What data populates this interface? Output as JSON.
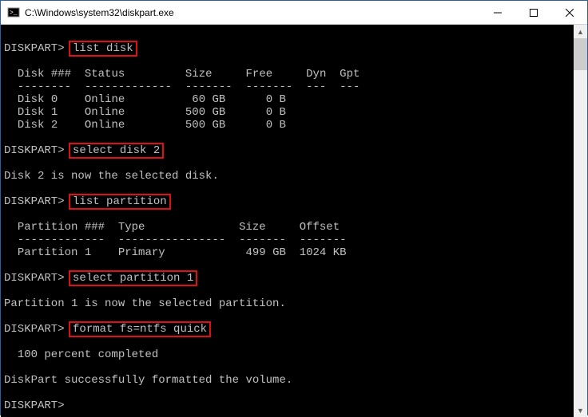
{
  "titlebar": {
    "title": "C:\\Windows\\system32\\diskpart.exe"
  },
  "prompt": "DISKPART>",
  "commands": {
    "c1": "list disk",
    "c2": "select disk 2",
    "c3": "list partition",
    "c4": "select partition 1",
    "c5": "format fs=ntfs quick"
  },
  "disk_header": {
    "col1": "Disk ###",
    "col2": "Status",
    "col3": "Size",
    "col4": "Free",
    "col5": "Dyn",
    "col6": "Gpt"
  },
  "disk_sep": {
    "col1": "--------",
    "col2": "-------------",
    "col3": "-------",
    "col4": "-------",
    "col5": "---",
    "col6": "---"
  },
  "disks": [
    {
      "id": "Disk 0",
      "status": "Online",
      "size": " 60 GB",
      "free": "    0 B"
    },
    {
      "id": "Disk 1",
      "status": "Online",
      "size": "500 GB",
      "free": "    0 B"
    },
    {
      "id": "Disk 2",
      "status": "Online",
      "size": "500 GB",
      "free": "    0 B"
    }
  ],
  "msg_disk_selected": "Disk 2 is now the selected disk.",
  "part_header": {
    "col1": "Partition ###",
    "col2": "Type",
    "col3": "Size",
    "col4": "Offset"
  },
  "part_sep": {
    "col1": "-------------",
    "col2": "----------------",
    "col3": "-------",
    "col4": "-------"
  },
  "partitions": [
    {
      "id": "Partition 1",
      "type": "Primary",
      "size": "499 GB",
      "offset": "1024 KB"
    }
  ],
  "msg_part_selected": "Partition 1 is now the selected partition.",
  "msg_progress": "  100 percent completed",
  "msg_success": "DiskPart successfully formatted the volume.",
  "chart_data": {
    "type": "table",
    "tables": [
      {
        "title": "list disk",
        "columns": [
          "Disk ###",
          "Status",
          "Size",
          "Free",
          "Dyn",
          "Gpt"
        ],
        "rows": [
          [
            "Disk 0",
            "Online",
            "60 GB",
            "0 B",
            "",
            ""
          ],
          [
            "Disk 1",
            "Online",
            "500 GB",
            "0 B",
            "",
            ""
          ],
          [
            "Disk 2",
            "Online",
            "500 GB",
            "0 B",
            "",
            ""
          ]
        ]
      },
      {
        "title": "list partition",
        "columns": [
          "Partition ###",
          "Type",
          "Size",
          "Offset"
        ],
        "rows": [
          [
            "Partition 1",
            "Primary",
            "499 GB",
            "1024 KB"
          ]
        ]
      }
    ]
  }
}
